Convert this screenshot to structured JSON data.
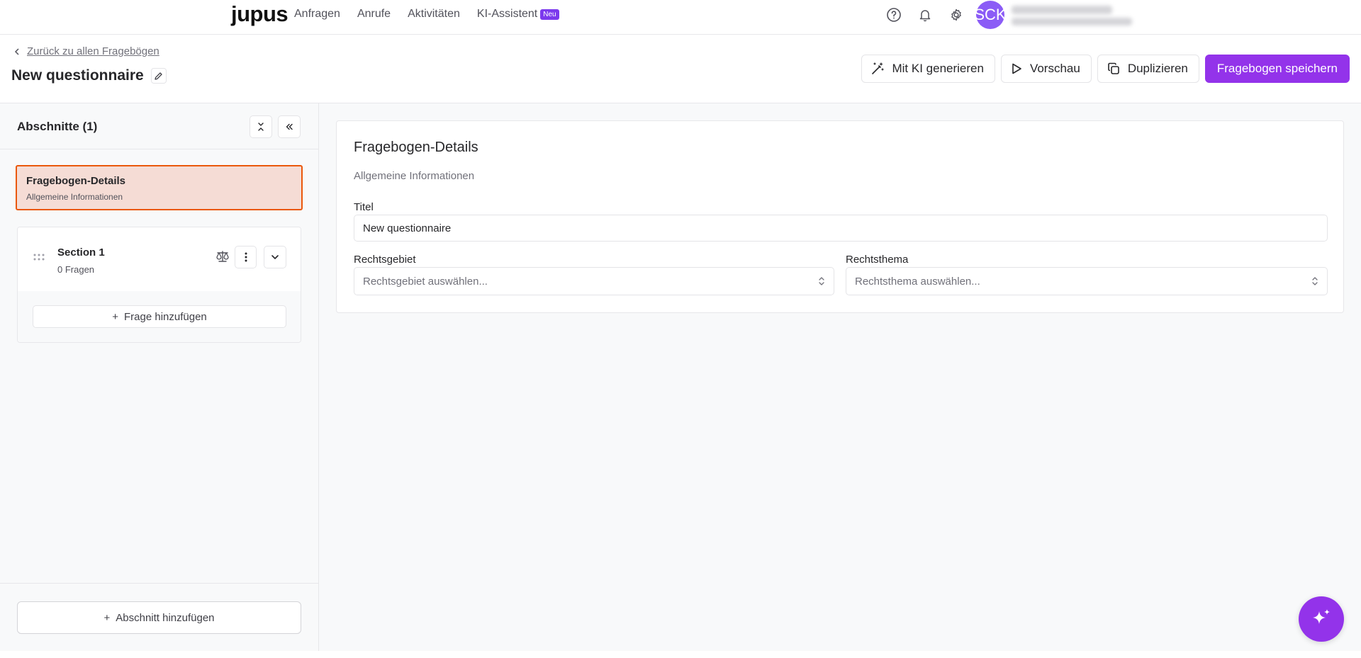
{
  "nav": {
    "logo": "jupus",
    "links": [
      {
        "label": "Anfragen"
      },
      {
        "label": "Anrufe"
      },
      {
        "label": "Aktivitäten"
      },
      {
        "label": "KI-Assistent",
        "badge": "Neu"
      }
    ],
    "avatar_initials": "SCK",
    "icons": [
      "help-icon",
      "bell-icon",
      "gear-icon"
    ]
  },
  "header": {
    "back_label": "Zurück zu allen Fragebögen",
    "title": "New questionnaire",
    "actions": {
      "ai_generate": "Mit KI generieren",
      "preview": "Vorschau",
      "duplicate": "Duplizieren",
      "save": "Fragebogen speichern"
    }
  },
  "sidebar": {
    "title": "Abschnitte (1)",
    "details_card": {
      "title": "Fragebogen-Details",
      "subtitle": "Allgemeine Informationen"
    },
    "sections": [
      {
        "title": "Section 1",
        "subtitle": "0 Fragen",
        "add_question": "Frage hinzufügen"
      }
    ],
    "add_section": "Abschnitt hinzufügen"
  },
  "main": {
    "panel_title": "Fragebogen-Details",
    "panel_subtitle": "Allgemeine Informationen",
    "fields": {
      "title_label": "Titel",
      "title_value": "New questionnaire",
      "area_label": "Rechtsgebiet",
      "area_placeholder": "Rechtsgebiet auswählen...",
      "topic_label": "Rechtsthema",
      "topic_placeholder": "Rechtsthema auswählen..."
    }
  },
  "colors": {
    "primary": "#9333ea",
    "badge": "#7c3aed",
    "active_border": "#ea580c",
    "active_bg": "#f5dcd5",
    "avatar": "#8b5cf6"
  }
}
